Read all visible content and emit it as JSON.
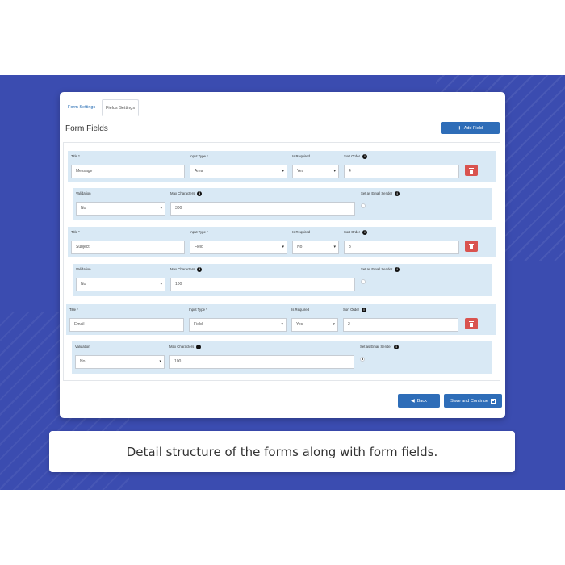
{
  "colors": {
    "banner": "#3b4cb0",
    "primary_button": "#2e6db8",
    "delete_button": "#d9534f",
    "row_background": "#d9e9f5"
  },
  "tabs": [
    {
      "label": "Form Settings"
    },
    {
      "label": "Fields Settings",
      "active": true
    }
  ],
  "page_title": "Form Fields",
  "add_field_label": "Add Field",
  "labels": {
    "title": "Title *",
    "input_type": "Input Type *",
    "is_required": "Is Required",
    "sort_order": "Sort Order",
    "validation": "Validation",
    "max_characters": "Max Characters",
    "set_as_email_sender": "Set as Email Sender"
  },
  "fields": [
    {
      "title": "Message",
      "input_type": "Area",
      "is_required": "Yes",
      "sort_order": "4",
      "validation": "No",
      "max_characters": "300",
      "email_sender": false
    },
    {
      "title": "Subject",
      "input_type": "Field",
      "is_required": "No",
      "sort_order": "3",
      "validation": "No",
      "max_characters": "100",
      "email_sender": false
    },
    {
      "title": "Email",
      "input_type": "Field",
      "is_required": "Yes",
      "sort_order": "2",
      "validation": "No",
      "max_characters": "100",
      "email_sender": true
    }
  ],
  "back_label": "Back",
  "save_label": "Save and Continue",
  "caption": "Detail structure of the forms along with form fields."
}
